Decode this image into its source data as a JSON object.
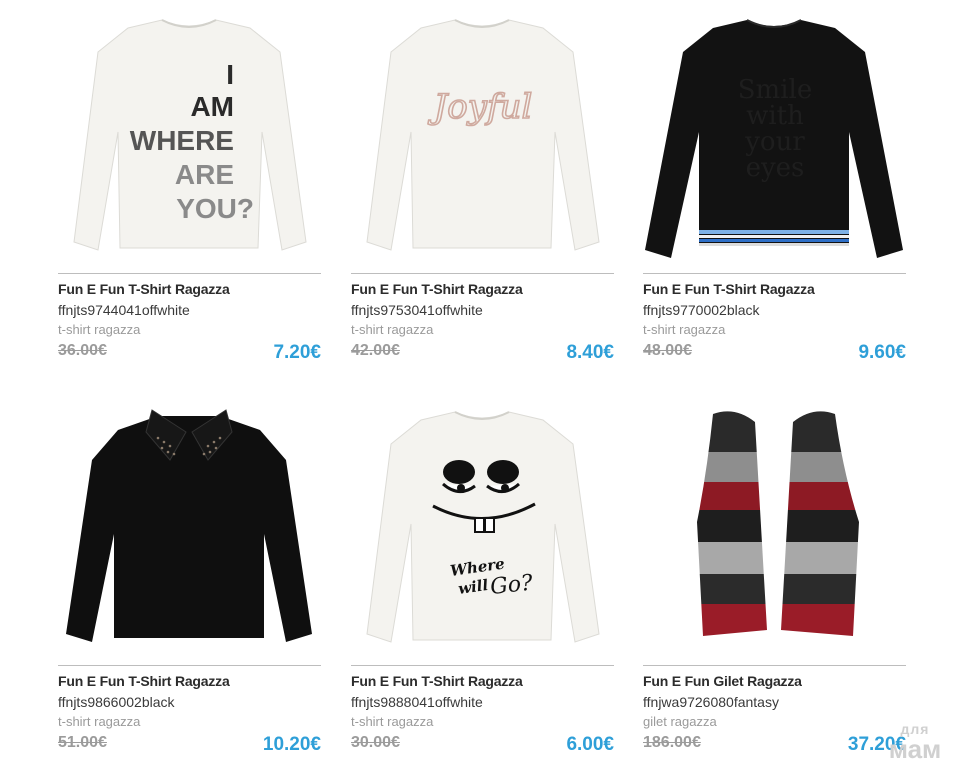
{
  "products": [
    {
      "title": "Fun E Fun T-Shirt Ragazza",
      "sku": "ffnjts9744041offwhite",
      "category": "t-shirt ragazza",
      "old_price": "36.00€",
      "price": "7.20€",
      "print_text": [
        "I",
        "AM",
        "WHERE",
        "ARE",
        "YOU?"
      ]
    },
    {
      "title": "Fun E Fun T-Shirt Ragazza",
      "sku": "ffnjts9753041offwhite",
      "category": "t-shirt ragazza",
      "old_price": "42.00€",
      "price": "8.40€",
      "print_text": "Joyful"
    },
    {
      "title": "Fun E Fun T-Shirt Ragazza",
      "sku": "ffnjts9770002black",
      "category": "t-shirt ragazza",
      "old_price": "48.00€",
      "price": "9.60€",
      "print_text": [
        "Smile",
        "with",
        "your",
        "eyes"
      ]
    },
    {
      "title": "Fun E Fun T-Shirt Ragazza",
      "sku": "ffnjts9866002black",
      "category": "t-shirt ragazza",
      "old_price": "51.00€",
      "price": "10.20€"
    },
    {
      "title": "Fun E Fun T-Shirt Ragazza",
      "sku": "ffnjts9888041offwhite",
      "category": "t-shirt ragazza",
      "old_price": "30.00€",
      "price": "6.00€",
      "print_text": [
        "Where",
        "will",
        "Go?"
      ]
    },
    {
      "title": "Fun E Fun Gilet Ragazza",
      "sku": "ffnjwa9726080fantasy",
      "category": "gilet ragazza",
      "old_price": "186.00€",
      "price": "37.20€"
    }
  ],
  "watermark": {
    "line1": "для",
    "line2": "мам"
  },
  "colors": {
    "price": "#2e9fd8",
    "old_price": "#9b9b9b",
    "divider": "#bdbdbd",
    "offwhite": "#f4f3ef",
    "black": "#111111"
  }
}
